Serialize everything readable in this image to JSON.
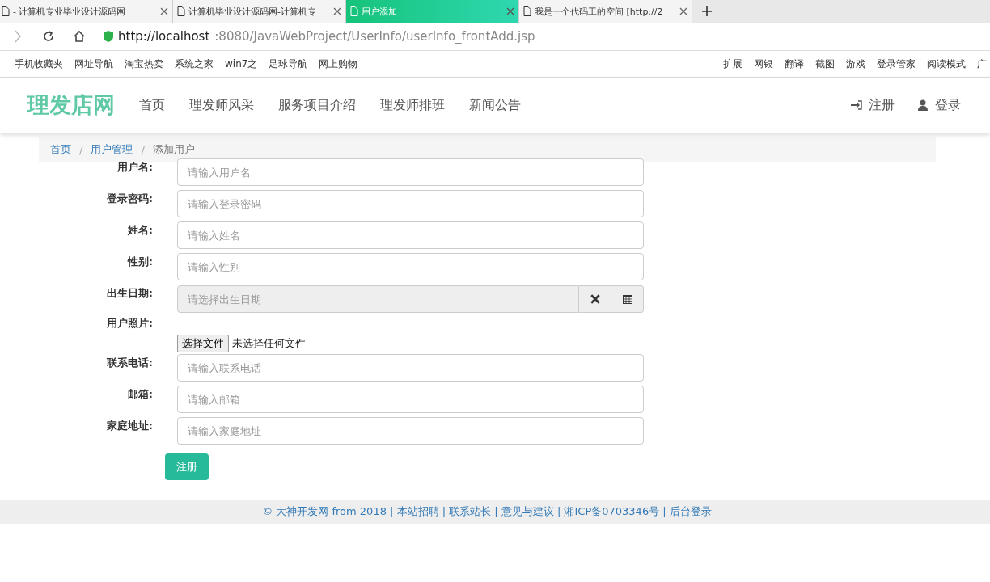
{
  "browser": {
    "tabs": [
      {
        "title": "- 计算机专业毕业设计源码网",
        "selected": false
      },
      {
        "title": "计算机毕业设计源码网-计算机专",
        "selected": false
      },
      {
        "title": "用户添加",
        "selected": true
      },
      {
        "title": "我是一个代码工的空间 [http://2",
        "selected": false
      }
    ],
    "url": {
      "host": "http://localhost",
      "rest": ":8080/JavaWebProject/UserInfo/userInfo_frontAdd.jsp"
    },
    "bookmarks": [
      "手机收藏夹",
      "网址导航",
      "淘宝热卖",
      "系统之家",
      "win7之",
      "足球导航",
      "网上购物"
    ],
    "tools": [
      "扩展",
      "网银",
      "翻译",
      "截图",
      "游戏",
      "登录管家",
      "阅读模式",
      "广"
    ]
  },
  "navbar": {
    "brand": "理发店网",
    "links": [
      "首页",
      "理发师风采",
      "服务项目介绍",
      "理发师排班",
      "新闻公告"
    ],
    "register": "注册",
    "login": "登录"
  },
  "breadcrumb_separator": "/",
  "breadcrumb": [
    {
      "label": "首页",
      "selected": false
    },
    {
      "label": "用户管理",
      "selected": false
    },
    {
      "label": "添加用户",
      "selected": true
    }
  ],
  "form": {
    "fields": [
      {
        "kind": "text",
        "label": "用户名:",
        "placeholder": "请输入用户名"
      },
      {
        "kind": "text",
        "label": "登录密码:",
        "placeholder": "请输入登录密码"
      },
      {
        "kind": "text",
        "label": "姓名:",
        "placeholder": "请输入姓名"
      },
      {
        "kind": "text",
        "label": "性别:",
        "placeholder": "请输入性别"
      },
      {
        "kind": "date",
        "label": "出生日期:",
        "placeholder": "请选择出生日期"
      },
      {
        "kind": "file",
        "label": "用户照片:",
        "button": "选择文件",
        "status": "未选择任何文件"
      },
      {
        "kind": "text",
        "label": "联系电话:",
        "placeholder": "请输入联系电话"
      },
      {
        "kind": "text",
        "label": "邮箱:",
        "placeholder": "请输入邮箱"
      },
      {
        "kind": "text",
        "label": "家庭地址:",
        "placeholder": "请输入家庭地址"
      }
    ],
    "submit": "注册"
  },
  "footer": "© 大神开发网 from 2018 | 本站招聘 | 联系站长 | 意见与建议 | 湘ICP备0703346号 | 后台登录"
}
